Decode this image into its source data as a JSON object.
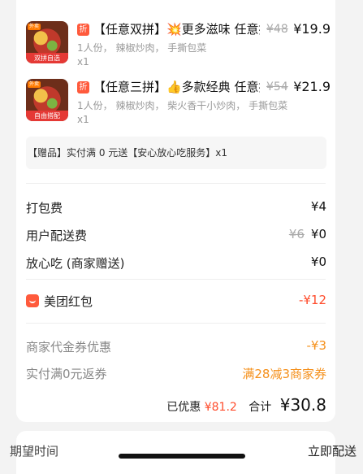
{
  "items": [
    {
      "thumb_tag": "外卖",
      "thumb_ribbon": "双拼自选",
      "discount_tag": "折",
      "name": "【任意双拼】💥更多滋味 任意拼…",
      "old_price": "¥48",
      "price": "¥19.9",
      "desc": "1人份， 辣椒炒肉， 手撕包菜",
      "qty": "x1"
    },
    {
      "thumb_tag": "外卖",
      "thumb_ribbon": "自由搭配",
      "discount_tag": "折",
      "name": "【任意三拼】👍多款经典 任意拼…",
      "old_price": "¥54",
      "price": "¥21.9",
      "desc": "1人份， 辣椒炒肉， 柴火香干小炒肉， 手撕包菜",
      "qty": "x1"
    }
  ],
  "gift": "【赠品】实付满 0 元送【安心放心吃服务】x1",
  "fees": {
    "packing_label": "打包费",
    "packing_value": "¥4",
    "delivery_label": "用户配送费",
    "delivery_old": "¥6",
    "delivery_value": "¥0",
    "safe_label": "放心吃 (商家赠送)",
    "safe_value": "¥0"
  },
  "redpacket": {
    "label": "美团红包",
    "value": "-¥12"
  },
  "coupons": {
    "voucher_label": "商家代金券优惠",
    "voucher_value": "-¥3",
    "return_label": "实付满0元返券",
    "return_value": "满28减3商家券"
  },
  "total": {
    "discount_label": "已优惠",
    "discount_value": "¥81.2",
    "total_label": "合计",
    "total_value": "¥30.8"
  },
  "expect": {
    "label": "期望时间",
    "value": "立即配送"
  },
  "colors": {
    "accent_red": "#ff4d2d",
    "accent_orange": "#f5901b"
  }
}
